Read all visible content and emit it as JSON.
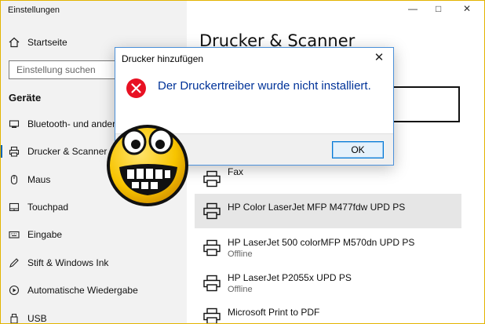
{
  "window": {
    "title": "Einstellungen",
    "controls": {
      "minimize": "—",
      "maximize": "□",
      "close": "✕"
    }
  },
  "sidebar": {
    "home_label": "Startseite",
    "search_placeholder": "Einstellung suchen",
    "section": "Geräte",
    "items": [
      {
        "label": "Bluetooth- und andere Geräte",
        "icon": "bluetooth-devices-icon"
      },
      {
        "label": "Drucker & Scanner",
        "icon": "printer-icon",
        "selected": true
      },
      {
        "label": "Maus",
        "icon": "mouse-icon"
      },
      {
        "label": "Touchpad",
        "icon": "touchpad-icon"
      },
      {
        "label": "Eingabe",
        "icon": "keyboard-icon"
      },
      {
        "label": "Stift & Windows Ink",
        "icon": "pen-icon"
      },
      {
        "label": "Automatische Wiedergabe",
        "icon": "autoplay-icon"
      },
      {
        "label": "USB",
        "icon": "usb-icon"
      }
    ],
    "accent_color": "#0063b1"
  },
  "main": {
    "title": "Drucker & Scanner",
    "printers": [
      {
        "name": "Fax",
        "status": ""
      },
      {
        "name": "HP Color LaserJet MFP M477fdw UPD PS",
        "status": "",
        "selected": true
      },
      {
        "name": "HP LaserJet 500 colorMFP M570dn UPD PS",
        "status": "Offline"
      },
      {
        "name": "HP LaserJet P2055x UPD PS",
        "status": "Offline"
      },
      {
        "name": "Microsoft Print to PDF",
        "status": ""
      }
    ]
  },
  "dialog": {
    "title": "Drucker hinzufügen",
    "close": "✕",
    "message": "Der Druckertreiber wurde nicht installiert.",
    "ok_label": "OK",
    "icon": "error-icon",
    "message_color": "#003399"
  },
  "overlay": {
    "icon": "grinning-smiley-icon"
  }
}
